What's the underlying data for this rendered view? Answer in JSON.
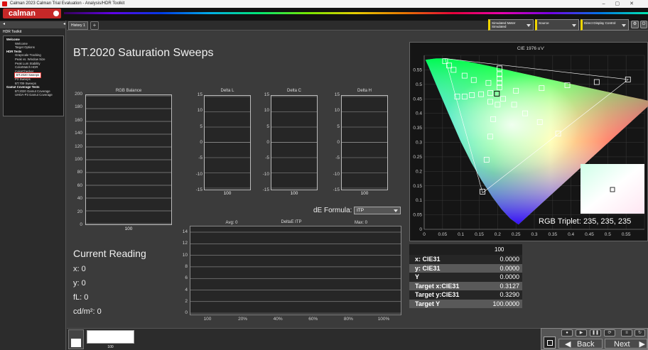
{
  "window": {
    "title": "Calman 2023 Calman Trial Evaluation - Analysis/HDR Toolkit",
    "controls": [
      "–",
      "▢",
      "✕"
    ]
  },
  "app": {
    "logo": "calman"
  },
  "sidebar": {
    "title": "HDR Toolkit",
    "tree": [
      {
        "label": "Welcome",
        "level": 0
      },
      {
        "label": "Welcome",
        "level": 1
      },
      {
        "label": "Target Options",
        "level": 1
      },
      {
        "label": "HDR Tests",
        "level": 0
      },
      {
        "label": "Grayscale Tracking",
        "level": 1
      },
      {
        "label": "Peak vs. Window Size",
        "level": 1
      },
      {
        "label": "Peak Lum Stability",
        "level": 1
      },
      {
        "label": "ColorMatch HDR",
        "level": 1
      },
      {
        "label": "ColorChecker",
        "level": 1
      },
      {
        "label": "BT.2020 Sweeps",
        "level": 1,
        "selected": true
      },
      {
        "label": "P3 Sweeps",
        "level": 1
      },
      {
        "label": "BT.709 Sweeps",
        "level": 1
      },
      {
        "label": "Gamut Coverage Tests",
        "level": 0
      },
      {
        "label": "BT.2020 Gamut Coverage",
        "level": 1
      },
      {
        "label": "UHDA-P3 Gamut Coverage",
        "level": 1
      }
    ]
  },
  "tabs": [
    {
      "label": "History 1"
    }
  ],
  "toolbar": {
    "meter": {
      "line1": "Simulated Meter",
      "line2": "Simulated"
    },
    "source": {
      "line1": "Source"
    },
    "display": {
      "line1": "Direct Display Control"
    }
  },
  "page": {
    "title": "BT.2020 Saturation Sweeps"
  },
  "rgb_balance": {
    "title": "RGB Balance",
    "ticks": [
      "200",
      "180",
      "160",
      "140",
      "120",
      "100",
      "80",
      "60",
      "40",
      "20",
      "0"
    ],
    "bottom": "100"
  },
  "delta_plots": [
    {
      "title": "Delta L",
      "ticks": [
        "15",
        "10",
        "5",
        "0",
        "-5",
        "-10",
        "-15"
      ],
      "bottom": "100"
    },
    {
      "title": "Delta C",
      "ticks": [
        "15",
        "10",
        "5",
        "0",
        "-5",
        "-10",
        "-15"
      ],
      "bottom": "100"
    },
    {
      "title": "Delta H",
      "ticks": [
        "15",
        "10",
        "5",
        "0",
        "-5",
        "-10",
        "-15"
      ],
      "bottom": "100"
    }
  ],
  "de_formula": {
    "label": "dE Formula:",
    "value": "ITP"
  },
  "deltae_chart": {
    "title": "DeltaE ITP",
    "avg": "Avg: 0",
    "max": "Max: 0",
    "yticks": [
      "14",
      "12",
      "10",
      "8",
      "6",
      "4",
      "2",
      "0"
    ],
    "xticks": [
      "100",
      "20%",
      "40%",
      "60%",
      "80%",
      "100%"
    ]
  },
  "current_reading": {
    "title": "Current Reading",
    "rows": [
      {
        "label": "x: 0"
      },
      {
        "label": "y: 0"
      },
      {
        "label": "fL: 0"
      },
      {
        "label": "cd/m²: 0"
      }
    ]
  },
  "cie": {
    "title": "CIE 1976 u'v'",
    "xticks": [
      "0",
      "0.05",
      "0.1",
      "0.15",
      "0.2",
      "0.25",
      "0.3",
      "0.35",
      "0.4",
      "0.45",
      "0.5",
      "0.55"
    ],
    "yticks": [
      "0.55",
      "0.5",
      "0.45",
      "0.4",
      "0.35",
      "0.3",
      "0.25",
      "0.2",
      "0.15",
      "0.1",
      "0.05",
      "0"
    ],
    "triplet": "RGB Triplet: 235, 235, 235"
  },
  "chart_data": {
    "type": "scatter",
    "title": "CIE 1976 u'v'",
    "xlim": [
      0,
      0.6
    ],
    "ylim": [
      0,
      0.6
    ],
    "gamut_triangle": [
      [
        0.556,
        0.517
      ],
      [
        0.057,
        0.589
      ],
      [
        0.159,
        0.126
      ]
    ],
    "target_points": [
      [
        0.057,
        0.58
      ],
      [
        0.068,
        0.565
      ],
      [
        0.08,
        0.55
      ],
      [
        0.11,
        0.53
      ],
      [
        0.135,
        0.515
      ],
      [
        0.175,
        0.505
      ],
      [
        0.205,
        0.555
      ],
      [
        0.205,
        0.535
      ],
      [
        0.205,
        0.52
      ],
      [
        0.205,
        0.505
      ],
      [
        0.205,
        0.49
      ],
      [
        0.215,
        0.45
      ],
      [
        0.09,
        0.458
      ],
      [
        0.11,
        0.458
      ],
      [
        0.13,
        0.463
      ],
      [
        0.155,
        0.466
      ],
      [
        0.18,
        0.47
      ],
      [
        0.198,
        0.468
      ],
      [
        0.25,
        0.478
      ],
      [
        0.32,
        0.487
      ],
      [
        0.39,
        0.497
      ],
      [
        0.47,
        0.508
      ],
      [
        0.555,
        0.517
      ],
      [
        0.2,
        0.43
      ],
      [
        0.245,
        0.43
      ],
      [
        0.275,
        0.4
      ],
      [
        0.315,
        0.37
      ],
      [
        0.365,
        0.33
      ],
      [
        0.18,
        0.44
      ],
      [
        0.188,
        0.38
      ],
      [
        0.18,
        0.32
      ],
      [
        0.17,
        0.24
      ],
      [
        0.159,
        0.13
      ]
    ],
    "white_point": [
      0.198,
      0.468
    ]
  },
  "results_table": {
    "header": "100",
    "rows": [
      {
        "label": "x: CIE31",
        "value": "0.0000"
      },
      {
        "label": "y: CIE31",
        "value": "0.0000"
      },
      {
        "label": "Y",
        "value": "0.0000"
      },
      {
        "label": "Target x:CIE31",
        "value": "0.3127"
      },
      {
        "label": "Target y:CIE31",
        "value": "0.3290"
      },
      {
        "label": "Target Y",
        "value": "100.0000"
      }
    ]
  },
  "bottom": {
    "swatch_label": "100",
    "back": "Back",
    "next": "Next"
  }
}
